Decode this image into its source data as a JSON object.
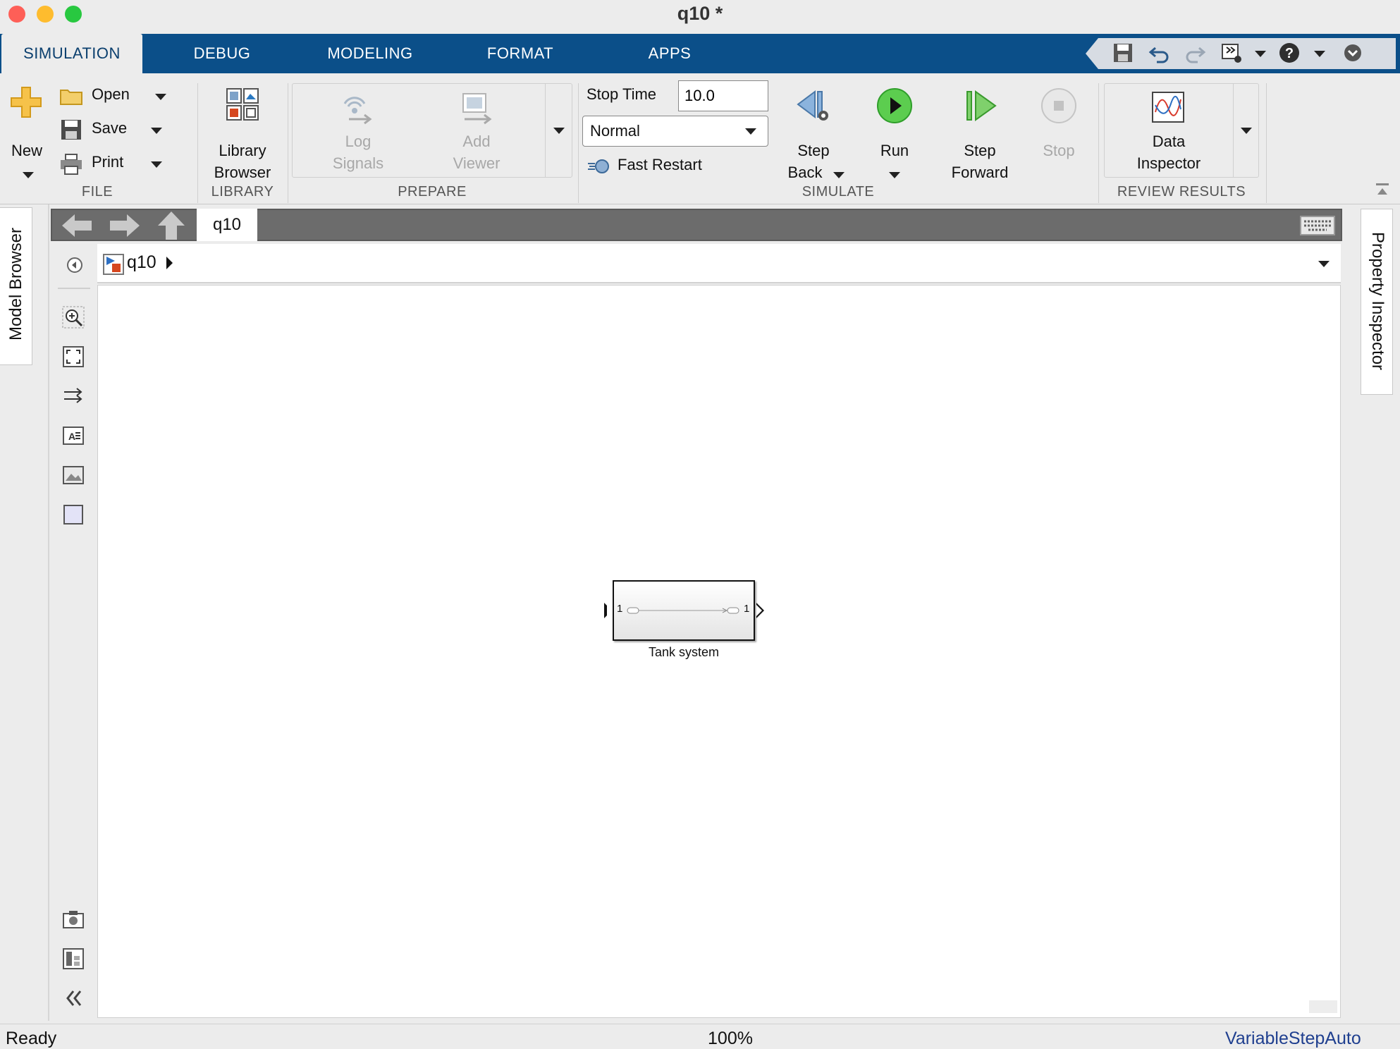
{
  "window": {
    "title": "q10 *"
  },
  "tabs": [
    {
      "label": "SIMULATION",
      "active": true
    },
    {
      "label": "DEBUG"
    },
    {
      "label": "MODELING"
    },
    {
      "label": "FORMAT"
    },
    {
      "label": "APPS"
    }
  ],
  "quick_access_icons": [
    "save-icon",
    "undo-icon",
    "redo-icon",
    "custom-run-icon",
    "help-icon",
    "minimize-ribbon-icon"
  ],
  "file": {
    "new_label": "New",
    "open_label": "Open",
    "save_label": "Save",
    "print_label": "Print",
    "section": "FILE"
  },
  "library": {
    "button_line1": "Library",
    "button_line2": "Browser",
    "section": "LIBRARY"
  },
  "prepare": {
    "log_line1": "Log",
    "log_line2": "Signals",
    "viewer_line1": "Add",
    "viewer_line2": "Viewer",
    "section": "PREPARE"
  },
  "simulate": {
    "stop_time_label": "Stop Time",
    "stop_time_value": "10.0",
    "mode_value": "Normal",
    "fast_restart_label": "Fast Restart",
    "step_back_line1": "Step",
    "step_back_line2": "Back",
    "run_label": "Run",
    "step_forward_line1": "Step",
    "step_forward_line2": "Forward",
    "stop_label": "Stop",
    "section": "SIMULATE"
  },
  "review": {
    "inspector_line1": "Data",
    "inspector_line2": "Inspector",
    "section": "REVIEW RESULTS"
  },
  "side_panels": {
    "left": "Model Browser",
    "right": "Property Inspector"
  },
  "explorer": {
    "tab_label": "q10",
    "address": "q10"
  },
  "block": {
    "name": "Tank system",
    "in_port": "1",
    "out_port": "1"
  },
  "status": {
    "left": "Ready",
    "zoom": "100%",
    "solver": "VariableStepAuto"
  },
  "colors": {
    "tab_bar": "#0b4f89",
    "run_green": "#3bbf3b",
    "solver_text": "#1f3f8f"
  }
}
